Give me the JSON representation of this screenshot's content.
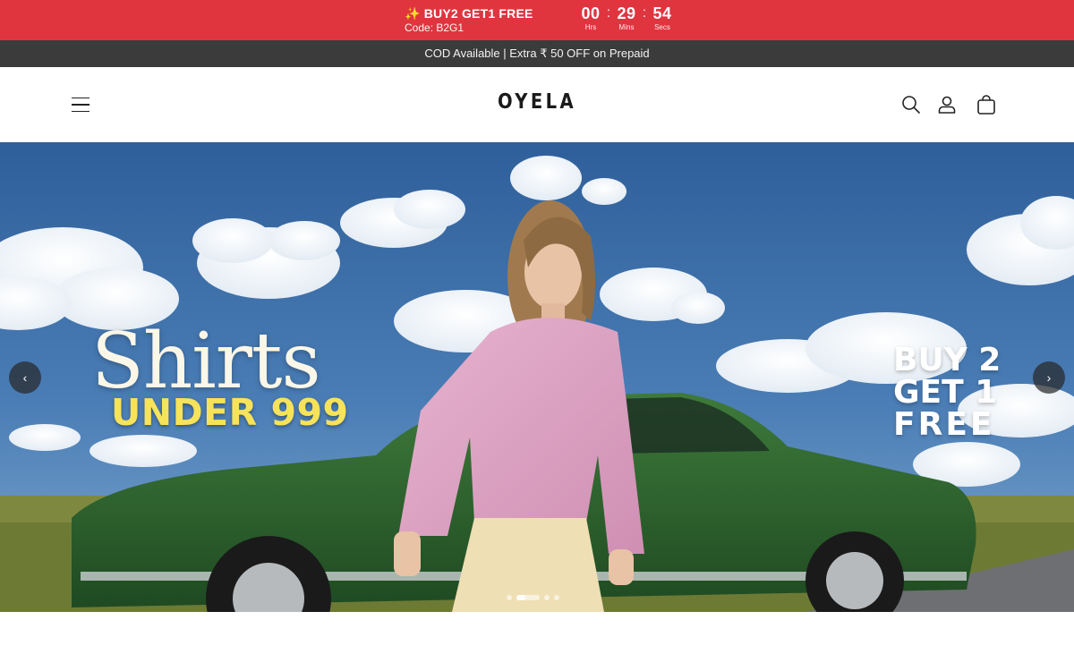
{
  "promo": {
    "offer_title": "✨ BUY2 GET1 FREE",
    "offer_code": "Code: B2G1",
    "timer": [
      {
        "value": "00",
        "label": "Hrs"
      },
      {
        "value": "29",
        "label": "Mins"
      },
      {
        "value": "54",
        "label": "Secs"
      }
    ],
    "timer_separator": ":",
    "background": "#e0353f"
  },
  "infobar": {
    "text": "COD Available | Extra ₹ 50 OFF on Prepaid",
    "background": "#3b3b3b"
  },
  "header": {
    "logo": "OYELA",
    "icons": [
      "menu-icon",
      "search-icon",
      "account-icon",
      "cart-icon"
    ]
  },
  "hero": {
    "headline": "Shirts",
    "subheadline": "UNDER 999",
    "offer_lines": [
      "BUY 2",
      "GET 1",
      "FREE"
    ],
    "prev_label": "‹",
    "next_label": "›",
    "slide_count": 5,
    "active_slide": 2,
    "headline_color": "#fbf7e8",
    "subheadline_color": "#f7e35a"
  }
}
